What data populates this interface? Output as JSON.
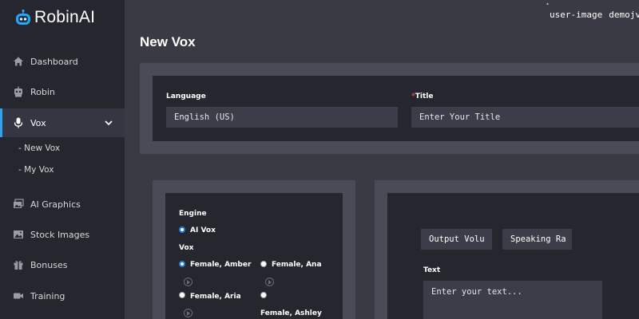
{
  "brand": {
    "name": "RobinAI",
    "accent": "#2ea3f2"
  },
  "topbar": {
    "avatar_alt": "user-image",
    "username": "demojvac"
  },
  "sidebar": {
    "items": [
      {
        "label": "Dashboard",
        "icon": "home-icon"
      },
      {
        "label": "Robin",
        "icon": "robot-icon"
      },
      {
        "label": "Vox",
        "icon": "microphone-icon",
        "active": true
      },
      {
        "label": "AI Graphics",
        "icon": "images-icon"
      },
      {
        "label": "Stock Images",
        "icon": "image-icon"
      },
      {
        "label": "Bonuses",
        "icon": "gift-icon"
      },
      {
        "label": "Training",
        "icon": "video-icon"
      }
    ],
    "vox_sub": [
      "- New Vox",
      "- My Vox"
    ]
  },
  "page": {
    "title": "New Vox"
  },
  "form": {
    "language_label": "Language",
    "language_value": "English (US)",
    "title_label": "Title",
    "title_required": "*",
    "title_placeholder": "Enter Your Title"
  },
  "engine": {
    "engine_label": "Engine",
    "engine_option": "AI Vox",
    "vox_label": "Vox",
    "voices": [
      "Female, Amber",
      "Female, Ana",
      "Female, Aria",
      "Female, Ashley"
    ]
  },
  "settings": {
    "output_volume": "Output Volu",
    "speaking_rate": "Speaking Ra",
    "text_label": "Text",
    "text_placeholder": "Enter your text..."
  }
}
